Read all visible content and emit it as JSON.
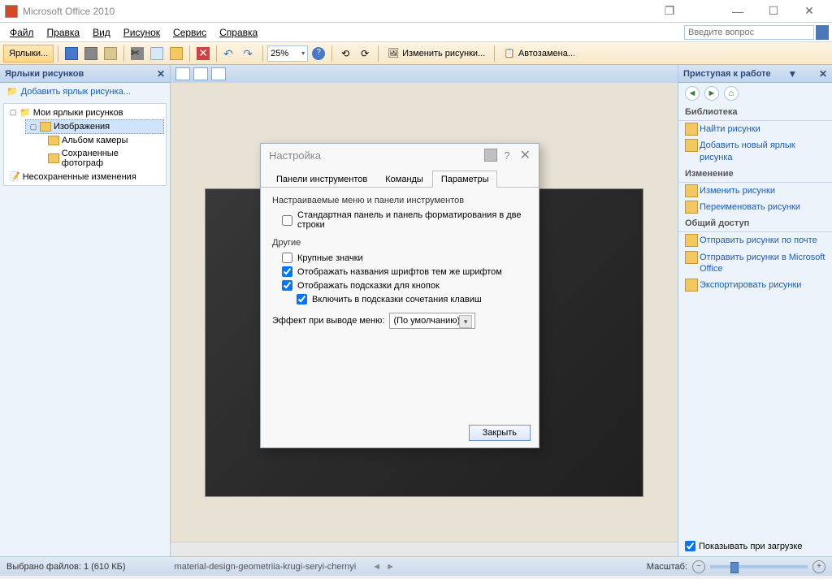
{
  "titlebar": {
    "title": "Microsoft Office 2010"
  },
  "menubar": {
    "items": [
      "Файл",
      "Правка",
      "Вид",
      "Рисунок",
      "Сервис",
      "Справка"
    ],
    "help_placeholder": "Введите вопрос"
  },
  "toolbar": {
    "shortcuts_label": "Ярлыки...",
    "zoom": "25%",
    "edit_pics": "Изменить рисунки...",
    "autoreplace": "Автозамена..."
  },
  "leftpanel": {
    "hdr": "Ярлыки рисунков",
    "add_link": "Добавить ярлык рисунка...",
    "tree": {
      "root": "Мои ярлыки рисунков",
      "images": "Изображения",
      "children": [
        "Альбом камеры",
        "Сохраненные фотограф"
      ],
      "unsaved": "Несохраненные изменения"
    }
  },
  "rightpanel": {
    "hdr": "Приступая к работе",
    "sections": {
      "library": {
        "title": "Библиотека",
        "links": [
          "Найти рисунки",
          "Добавить новый ярлык рисунка"
        ]
      },
      "change": {
        "title": "Изменение",
        "links": [
          "Изменить рисунки",
          "Переименовать рисунки"
        ]
      },
      "share": {
        "title": "Общий доступ",
        "links": [
          "Отправить рисунки по почте",
          "Отправить рисунки в Microsoft Office",
          "Экспортировать рисунки"
        ]
      }
    },
    "show_on_load": "Показывать при загрузке"
  },
  "dialog": {
    "title": "Настройка",
    "tabs": [
      "Панели инструментов",
      "Команды",
      "Параметры"
    ],
    "active_tab": 2,
    "grp1_label": "Настраиваемые меню и панели инструментов",
    "chk_std": "Стандартная панель и панель форматирования в две строки",
    "grp2_label": "Другие",
    "chk_large": "Крупные значки",
    "chk_fonts": "Отображать названия шрифтов тем же шрифтом",
    "chk_tips": "Отображать подсказки для кнопок",
    "chk_keys": "Включить в подсказки сочетания клавиш",
    "effect_label": "Эффект при выводе меню:",
    "effect_value": "(По умолчанию)",
    "close_btn": "Закрыть"
  },
  "statusbar": {
    "selection": "Выбрано файлов: 1 (610 КБ)",
    "filename": "material-design-geometriia-krugi-seryi-chernyi",
    "zoom_label": "Масштаб:"
  }
}
